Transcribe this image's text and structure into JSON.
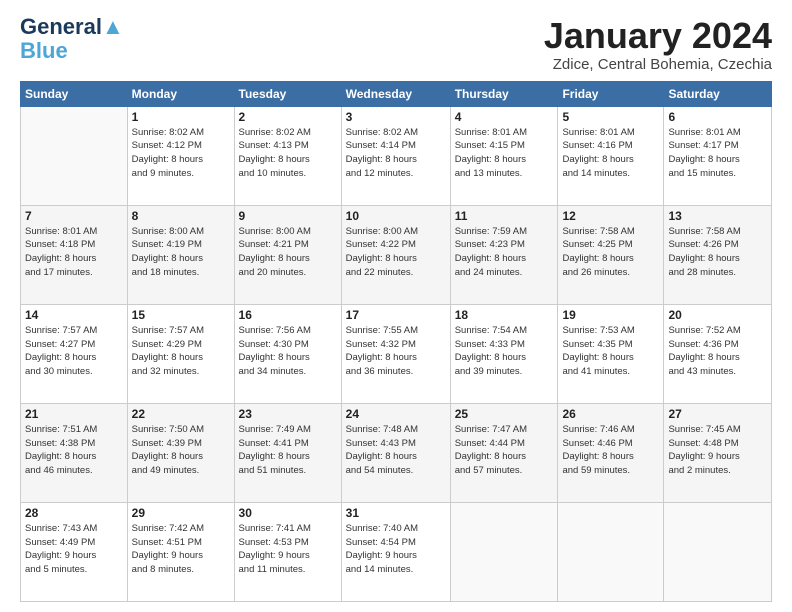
{
  "logo": {
    "line1": "General",
    "line2": "Blue",
    "tagline": "▲"
  },
  "header": {
    "month": "January 2024",
    "location": "Zdice, Central Bohemia, Czechia"
  },
  "weekdays": [
    "Sunday",
    "Monday",
    "Tuesday",
    "Wednesday",
    "Thursday",
    "Friday",
    "Saturday"
  ],
  "weeks": [
    [
      {
        "day": "",
        "info": ""
      },
      {
        "day": "1",
        "info": "Sunrise: 8:02 AM\nSunset: 4:12 PM\nDaylight: 8 hours\nand 9 minutes."
      },
      {
        "day": "2",
        "info": "Sunrise: 8:02 AM\nSunset: 4:13 PM\nDaylight: 8 hours\nand 10 minutes."
      },
      {
        "day": "3",
        "info": "Sunrise: 8:02 AM\nSunset: 4:14 PM\nDaylight: 8 hours\nand 12 minutes."
      },
      {
        "day": "4",
        "info": "Sunrise: 8:01 AM\nSunset: 4:15 PM\nDaylight: 8 hours\nand 13 minutes."
      },
      {
        "day": "5",
        "info": "Sunrise: 8:01 AM\nSunset: 4:16 PM\nDaylight: 8 hours\nand 14 minutes."
      },
      {
        "day": "6",
        "info": "Sunrise: 8:01 AM\nSunset: 4:17 PM\nDaylight: 8 hours\nand 15 minutes."
      }
    ],
    [
      {
        "day": "7",
        "info": "Sunrise: 8:01 AM\nSunset: 4:18 PM\nDaylight: 8 hours\nand 17 minutes."
      },
      {
        "day": "8",
        "info": "Sunrise: 8:00 AM\nSunset: 4:19 PM\nDaylight: 8 hours\nand 18 minutes."
      },
      {
        "day": "9",
        "info": "Sunrise: 8:00 AM\nSunset: 4:21 PM\nDaylight: 8 hours\nand 20 minutes."
      },
      {
        "day": "10",
        "info": "Sunrise: 8:00 AM\nSunset: 4:22 PM\nDaylight: 8 hours\nand 22 minutes."
      },
      {
        "day": "11",
        "info": "Sunrise: 7:59 AM\nSunset: 4:23 PM\nDaylight: 8 hours\nand 24 minutes."
      },
      {
        "day": "12",
        "info": "Sunrise: 7:58 AM\nSunset: 4:25 PM\nDaylight: 8 hours\nand 26 minutes."
      },
      {
        "day": "13",
        "info": "Sunrise: 7:58 AM\nSunset: 4:26 PM\nDaylight: 8 hours\nand 28 minutes."
      }
    ],
    [
      {
        "day": "14",
        "info": "Sunrise: 7:57 AM\nSunset: 4:27 PM\nDaylight: 8 hours\nand 30 minutes."
      },
      {
        "day": "15",
        "info": "Sunrise: 7:57 AM\nSunset: 4:29 PM\nDaylight: 8 hours\nand 32 minutes."
      },
      {
        "day": "16",
        "info": "Sunrise: 7:56 AM\nSunset: 4:30 PM\nDaylight: 8 hours\nand 34 minutes."
      },
      {
        "day": "17",
        "info": "Sunrise: 7:55 AM\nSunset: 4:32 PM\nDaylight: 8 hours\nand 36 minutes."
      },
      {
        "day": "18",
        "info": "Sunrise: 7:54 AM\nSunset: 4:33 PM\nDaylight: 8 hours\nand 39 minutes."
      },
      {
        "day": "19",
        "info": "Sunrise: 7:53 AM\nSunset: 4:35 PM\nDaylight: 8 hours\nand 41 minutes."
      },
      {
        "day": "20",
        "info": "Sunrise: 7:52 AM\nSunset: 4:36 PM\nDaylight: 8 hours\nand 43 minutes."
      }
    ],
    [
      {
        "day": "21",
        "info": "Sunrise: 7:51 AM\nSunset: 4:38 PM\nDaylight: 8 hours\nand 46 minutes."
      },
      {
        "day": "22",
        "info": "Sunrise: 7:50 AM\nSunset: 4:39 PM\nDaylight: 8 hours\nand 49 minutes."
      },
      {
        "day": "23",
        "info": "Sunrise: 7:49 AM\nSunset: 4:41 PM\nDaylight: 8 hours\nand 51 minutes."
      },
      {
        "day": "24",
        "info": "Sunrise: 7:48 AM\nSunset: 4:43 PM\nDaylight: 8 hours\nand 54 minutes."
      },
      {
        "day": "25",
        "info": "Sunrise: 7:47 AM\nSunset: 4:44 PM\nDaylight: 8 hours\nand 57 minutes."
      },
      {
        "day": "26",
        "info": "Sunrise: 7:46 AM\nSunset: 4:46 PM\nDaylight: 8 hours\nand 59 minutes."
      },
      {
        "day": "27",
        "info": "Sunrise: 7:45 AM\nSunset: 4:48 PM\nDaylight: 9 hours\nand 2 minutes."
      }
    ],
    [
      {
        "day": "28",
        "info": "Sunrise: 7:43 AM\nSunset: 4:49 PM\nDaylight: 9 hours\nand 5 minutes."
      },
      {
        "day": "29",
        "info": "Sunrise: 7:42 AM\nSunset: 4:51 PM\nDaylight: 9 hours\nand 8 minutes."
      },
      {
        "day": "30",
        "info": "Sunrise: 7:41 AM\nSunset: 4:53 PM\nDaylight: 9 hours\nand 11 minutes."
      },
      {
        "day": "31",
        "info": "Sunrise: 7:40 AM\nSunset: 4:54 PM\nDaylight: 9 hours\nand 14 minutes."
      },
      {
        "day": "",
        "info": ""
      },
      {
        "day": "",
        "info": ""
      },
      {
        "day": "",
        "info": ""
      }
    ]
  ]
}
